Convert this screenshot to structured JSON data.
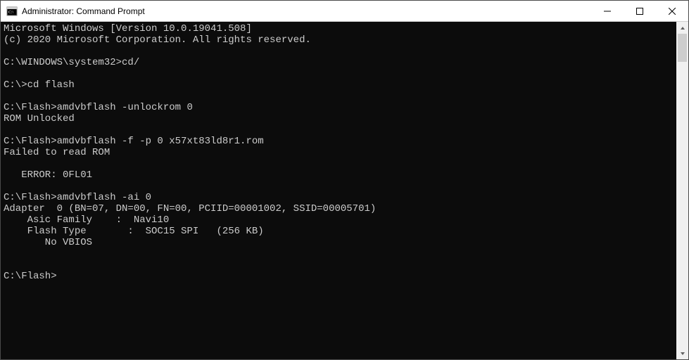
{
  "window": {
    "title": "Administrator: Command Prompt"
  },
  "terminal": {
    "lines": [
      "Microsoft Windows [Version 10.0.19041.508]",
      "(c) 2020 Microsoft Corporation. All rights reserved.",
      "",
      "C:\\WINDOWS\\system32>cd/",
      "",
      "C:\\>cd flash",
      "",
      "C:\\Flash>amdvbflash -unlockrom 0",
      "ROM Unlocked",
      "",
      "C:\\Flash>amdvbflash -f -p 0 x57xt83ld8r1.rom",
      "Failed to read ROM",
      "",
      "   ERROR: 0FL01",
      "",
      "C:\\Flash>amdvbflash -ai 0",
      "Adapter  0 (BN=07, DN=00, FN=00, PCIID=00001002, SSID=00005701)",
      "    Asic Family    :  Navi10",
      "    Flash Type       :  SOC15 SPI   (256 KB)",
      "       No VBIOS",
      "",
      "",
      "C:\\Flash>"
    ]
  }
}
